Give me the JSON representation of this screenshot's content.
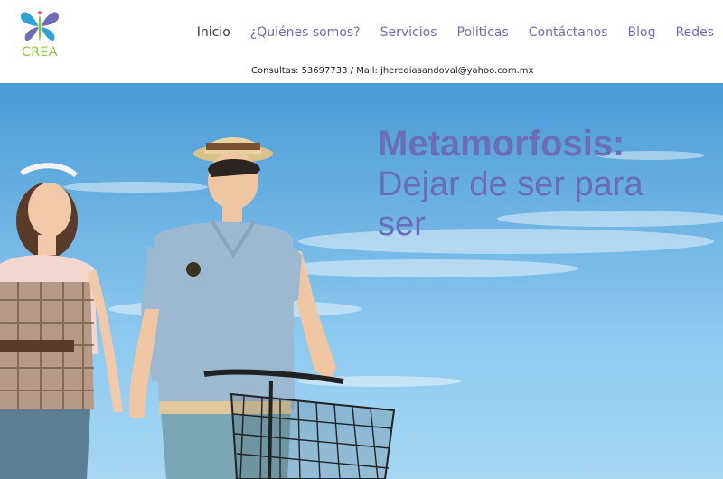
{
  "brand": {
    "logo_text": "CREA",
    "colors": {
      "purple": "#6c6db8",
      "green": "#8ac63f",
      "blue": "#2ea3d8",
      "sky": "#6eb4e4"
    }
  },
  "nav": {
    "items": [
      {
        "label": "Inicio",
        "active": true
      },
      {
        "label": "¿Quiénes somos?"
      },
      {
        "label": "Servicios"
      },
      {
        "label": "Politicas"
      },
      {
        "label": "Contáctanos"
      },
      {
        "label": "Blog"
      },
      {
        "label": "Redes"
      }
    ]
  },
  "contact": {
    "phone_text": "Consultas: 53697733 / Mail: ",
    "email": "jherediasandoval@yahoo.com.mx"
  },
  "hero": {
    "title_bold": "Metamorfosis:",
    "title_line2": "Dejar de ser para",
    "title_line3": "ser"
  }
}
